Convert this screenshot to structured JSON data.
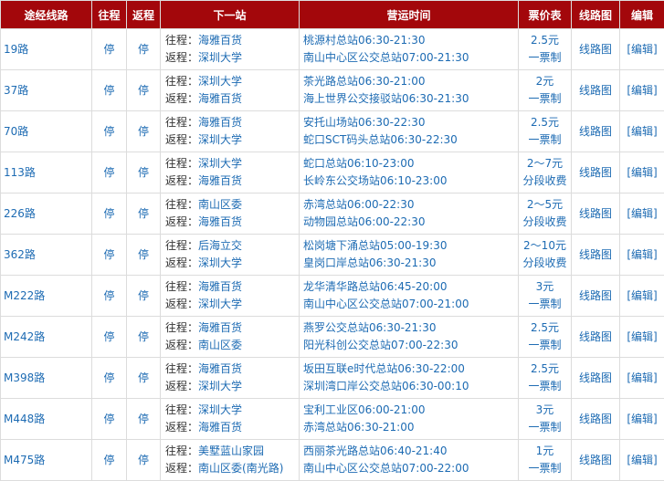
{
  "headers": {
    "route": "途经线路",
    "outbound": "往程",
    "return": "返程",
    "next_stop": "下一站",
    "hours": "营运时间",
    "fare": "票价表",
    "map": "线路图",
    "edit": "编辑"
  },
  "rows": [
    {
      "route": "19路",
      "out": "停",
      "ret": "停",
      "next_out": "海雅百货",
      "next_ret": "深圳大学",
      "time1": "桃源村总站06:30-21:30",
      "time2": "南山中心区公交总站07:00-21:30",
      "fare1": "2.5元",
      "fare2": "一票制",
      "map": "线路图",
      "edit": "[编辑]"
    },
    {
      "route": "37路",
      "out": "停",
      "ret": "停",
      "next_out": "深圳大学",
      "next_ret": "海雅百货",
      "time1": "茶光路总站06:30-21:00",
      "time2": "海上世界公交接驳站06:30-21:30",
      "fare1": "2元",
      "fare2": "一票制",
      "map": "线路图",
      "edit": "[编辑]"
    },
    {
      "route": "70路",
      "out": "停",
      "ret": "停",
      "next_out": "海雅百货",
      "next_ret": "深圳大学",
      "time1": "安托山场站06:30-22:30",
      "time2": "蛇口SCT码头总站06:30-22:30",
      "fare1": "2.5元",
      "fare2": "一票制",
      "map": "线路图",
      "edit": "[编辑]"
    },
    {
      "route": "113路",
      "out": "停",
      "ret": "停",
      "next_out": "深圳大学",
      "next_ret": "海雅百货",
      "time1": "蛇口总站06:10-23:00",
      "time2": "长岭东公交场站06:10-23:00",
      "fare1": "2～7元",
      "fare2": "分段收费",
      "map": "线路图",
      "edit": "[编辑]"
    },
    {
      "route": "226路",
      "out": "停",
      "ret": "停",
      "next_out": "南山区委",
      "next_ret": "海雅百货",
      "time1": "赤湾总站06:00-22:30",
      "time2": "动物园总站06:00-22:30",
      "fare1": "2～5元",
      "fare2": "分段收费",
      "map": "线路图",
      "edit": "[编辑]"
    },
    {
      "route": "362路",
      "out": "停",
      "ret": "停",
      "next_out": "后海立交",
      "next_ret": "深圳大学",
      "time1": "松岗塘下涌总站05:00-19:30",
      "time2": "皇岗口岸总站06:30-21:30",
      "fare1": "2～10元",
      "fare2": "分段收费",
      "map": "线路图",
      "edit": "[编辑]"
    },
    {
      "route": "M222路",
      "out": "停",
      "ret": "停",
      "next_out": "海雅百货",
      "next_ret": "深圳大学",
      "time1": "龙华清华路总站06:45-20:00",
      "time2": "南山中心区公交总站07:00-21:00",
      "fare1": "3元",
      "fare2": "一票制",
      "map": "线路图",
      "edit": "[编辑]"
    },
    {
      "route": "M242路",
      "out": "停",
      "ret": "停",
      "next_out": "海雅百货",
      "next_ret": "南山区委",
      "time1": "燕罗公交总站06:30-21:30",
      "time2": "阳光科创公交总站07:00-22:30",
      "fare1": "2.5元",
      "fare2": "一票制",
      "map": "线路图",
      "edit": "[编辑]"
    },
    {
      "route": "M398路",
      "out": "停",
      "ret": "停",
      "next_out": "海雅百货",
      "next_ret": "深圳大学",
      "time1": "坂田互联e时代总站06:30-22:00",
      "time2": "深圳湾口岸公交总站06:30-00:10",
      "fare1": "2.5元",
      "fare2": "一票制",
      "map": "线路图",
      "edit": "[编辑]"
    },
    {
      "route": "M448路",
      "out": "停",
      "ret": "停",
      "next_out": "深圳大学",
      "next_ret": "海雅百货",
      "time1": "宝利工业区06:00-21:00",
      "time2": "赤湾总站06:30-21:00",
      "fare1": "3元",
      "fare2": "一票制",
      "map": "线路图",
      "edit": "[编辑]"
    },
    {
      "route": "M475路",
      "out": "停",
      "ret": "停",
      "next_out": "美墅蓝山家园",
      "next_ret": "南山区委(南光路)",
      "time1": "西丽茶光路总站06:40-21:40",
      "time2": "南山中心区公交总站07:00-22:00",
      "fare1": "1元",
      "fare2": "一票制",
      "map": "线路图",
      "edit": "[编辑]"
    }
  ],
  "labels": {
    "out": "往程：",
    "ret": "返程："
  }
}
